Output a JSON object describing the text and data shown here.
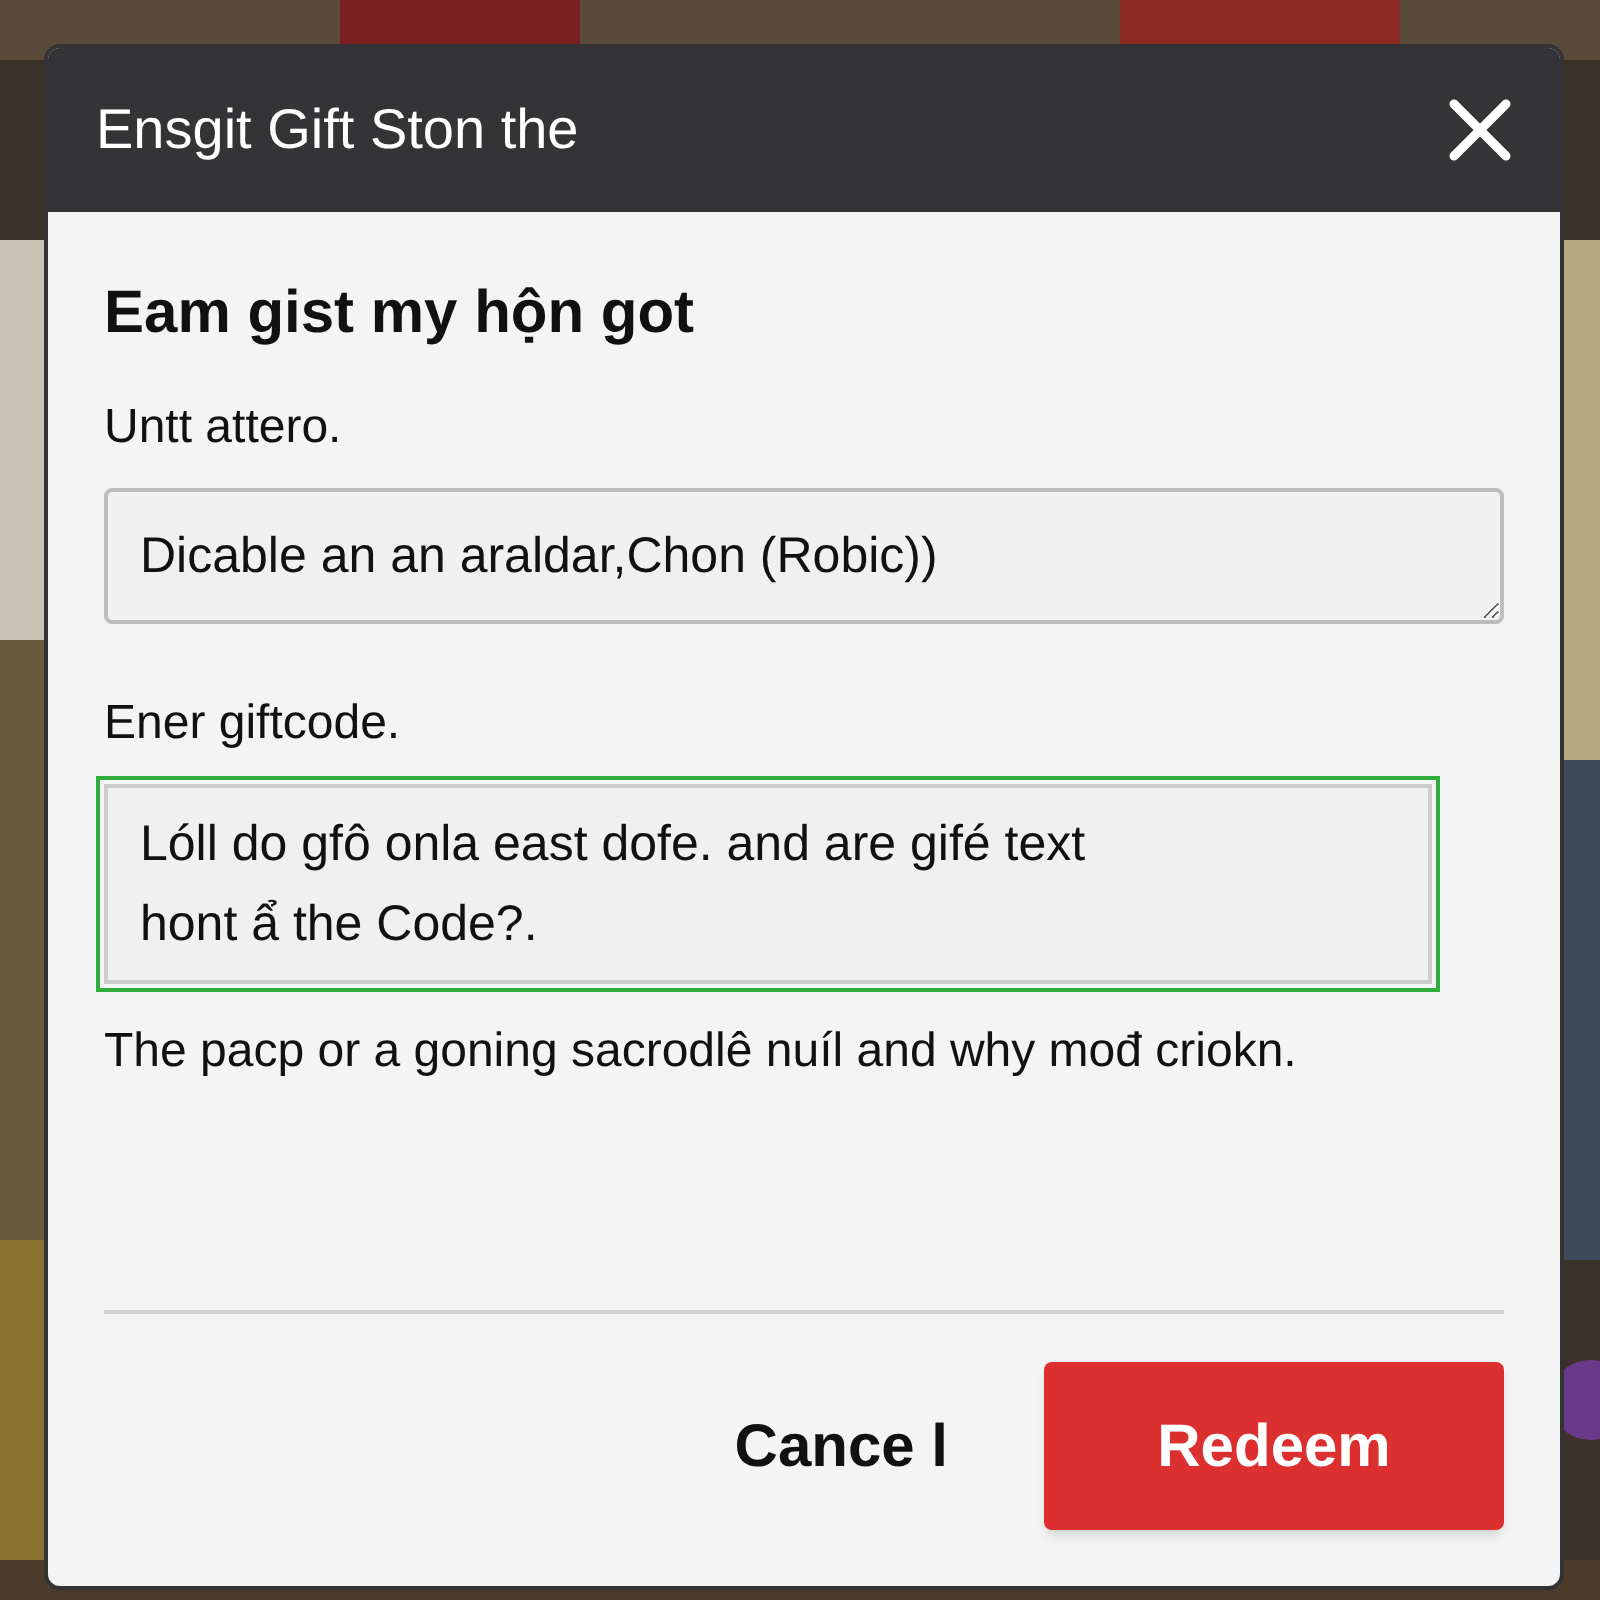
{
  "dialog": {
    "title": "Ensgit Gift Ston the",
    "heading": "Eam gist my hộn got",
    "fields": [
      {
        "label": "Untt attero.",
        "value": "Dicable an an araldar,Chon (Robic))",
        "focused": false
      },
      {
        "label": "Ener giftcode.",
        "value": "Lóll do gfô onla east dofe. and are gifé text\nhont ẩ the Code?.",
        "focused": true
      }
    ],
    "note": "The pacp or a goning sacrodlê nuíl and why mođ criokn.",
    "buttons": [
      {
        "label": "Cance l",
        "kind": "secondary"
      },
      {
        "label": "Redeem",
        "kind": "primary"
      }
    ]
  }
}
